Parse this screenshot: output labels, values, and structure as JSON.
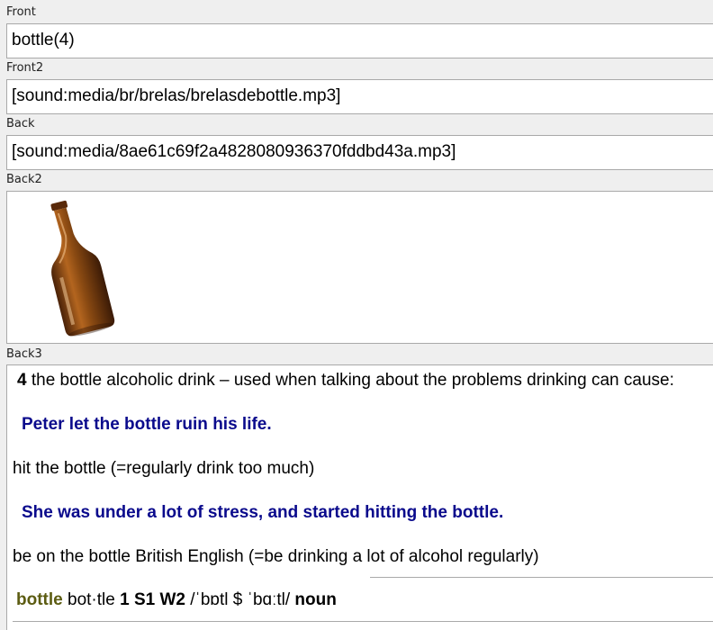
{
  "fields": {
    "front": {
      "label": "Front",
      "value": "bottle(4)"
    },
    "front2": {
      "label": "Front2",
      "value": "[sound:media/br/brelas/brelasdebottle.mp3]"
    },
    "back": {
      "label": "Back",
      "value": "[sound:media/8ae61c69f2a4828080936370fddbd43a.mp3]"
    },
    "back2": {
      "label": "Back2",
      "image": "bottle-icon"
    },
    "back3": {
      "label": "Back3",
      "sense_number": "4",
      "definition": " the bottle alcoholic drink – used when talking about the problems drinking can cause:",
      "example1": "Peter let the bottle ruin his life.",
      "phrase1": "hit the bottle (=regularly drink too much)",
      "example2": "She was under a lot of stress, and started hitting the bottle.",
      "phrase2": "be on the bottle British English (=be drinking a lot of alcohol regularly)",
      "headword": "bottle",
      "syllables": " bot·tle ",
      "freq": "1 S1 W2",
      "pron": " /ˈbɒtl $ ˈbɑːtl/ ",
      "pos": "noun"
    }
  },
  "colors": {
    "example": "#0a0a8c",
    "headword": "#5c5c12",
    "bottle_glass": "#8a4a12"
  }
}
